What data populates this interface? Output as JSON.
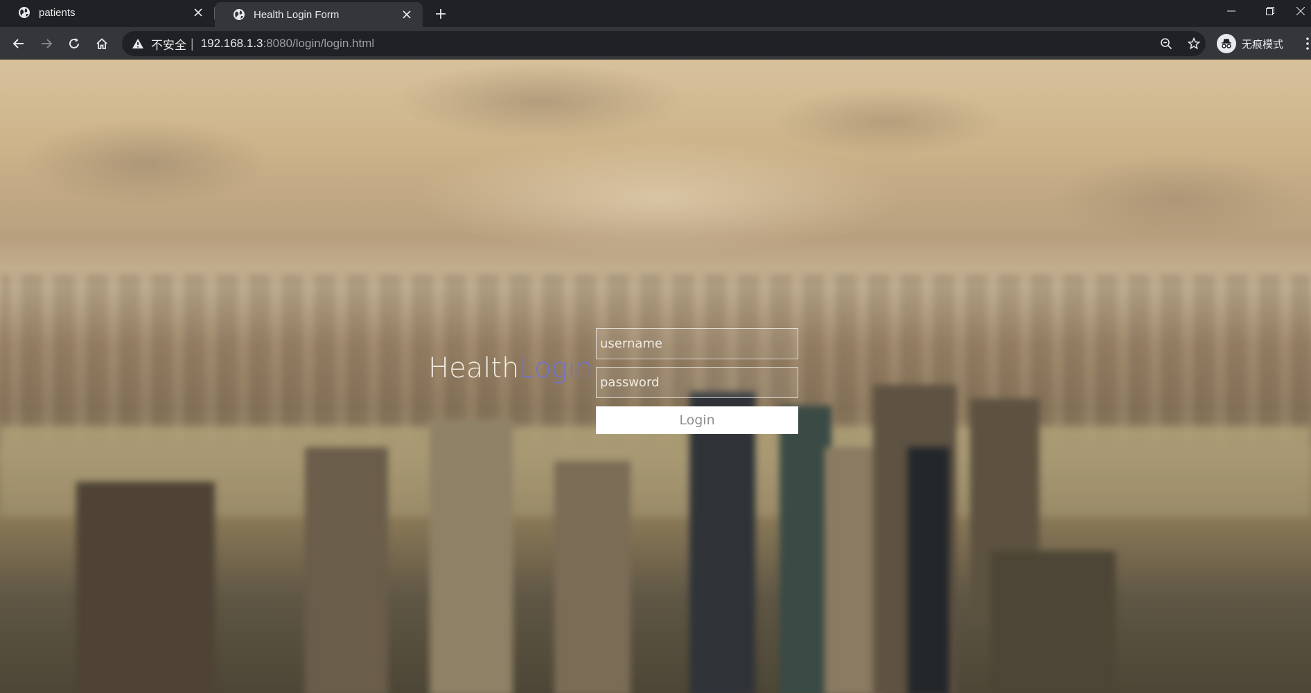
{
  "browser": {
    "tabs": [
      {
        "title": "patients",
        "active": false
      },
      {
        "title": "Health Login Form",
        "active": true
      }
    ],
    "address": {
      "security_label": "不安全",
      "host": "192.168.1.3",
      "path": ":8080/login/login.html"
    },
    "profile_label": "无痕模式"
  },
  "page": {
    "title_part1": "Health",
    "title_part2": "Login",
    "username_placeholder": "username",
    "password_placeholder": "password",
    "login_label": "Login"
  },
  "colors": {
    "title_accent": "#6f72d8",
    "chrome_dark": "#202124",
    "chrome_toolbar": "#35363a"
  }
}
